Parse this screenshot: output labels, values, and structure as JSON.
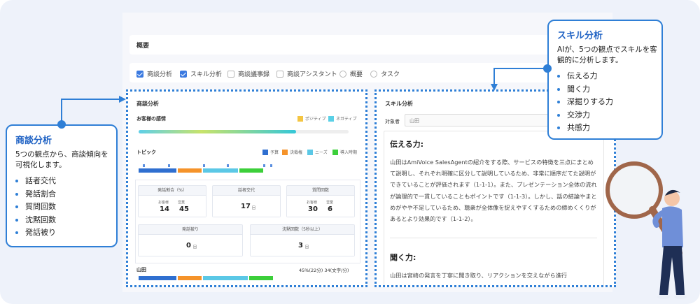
{
  "summary": {
    "label": "概要"
  },
  "tabs": [
    {
      "label": "商談分析",
      "checked": true
    },
    {
      "label": "スキル分析",
      "checked": true
    },
    {
      "label": "商談議事録",
      "checked": false
    },
    {
      "label": "商談アシスタント",
      "checked": false
    },
    {
      "label": "概要",
      "checked": false
    },
    {
      "label": "タスク",
      "checked": false
    }
  ],
  "left_panel": {
    "title": "商談分析",
    "sentiment": {
      "title": "お客様の感情",
      "legend_positive": "ポジティブ",
      "legend_negative": "ネガティブ",
      "positive_color": "#f4c542",
      "negative_color": "#5ad0e6",
      "fill_fraction": 0.75
    },
    "topic": {
      "title": "トピック",
      "legend": [
        "予算",
        "決裁権",
        "ニーズ",
        "導入時期"
      ],
      "colors": [
        "#2f6fd0",
        "#f5932a",
        "#5bc8e6",
        "#3ccf3a"
      ]
    },
    "metrics": {
      "talk_ratio": {
        "label": "発話割合（%）",
        "customer_label": "お客様",
        "sales_label": "営業",
        "customer": "14",
        "sales": "45"
      },
      "speaker_changes": {
        "label": "話者交代",
        "value": "17",
        "unit": "回"
      },
      "questions": {
        "label": "質問回数",
        "customer_label": "お客様",
        "sales_label": "営業",
        "customer": "30",
        "sales": "6"
      },
      "overlap": {
        "label": "発話被り",
        "value": "0",
        "unit": "回"
      },
      "silence": {
        "label": "沈黙回数（5秒以上）",
        "value": "3",
        "unit": "回"
      }
    },
    "speaker": {
      "name": "山田",
      "stat": "45%(22分) 34(文字/分)"
    }
  },
  "right_panel": {
    "title": "スキル分析",
    "target_label": "対象者",
    "target_value": "山田",
    "section1_heading": "伝える力:",
    "section1_text": "山田はAmiVoice SalesAgentの紹介をする際、サービスの特徴を三点にまとめて説明し、それぞれ明確に区分して説明しているため、非常に順序だてた説明ができていることが評価されます（1-1-1）。また、プレゼンテーション全体の流れが論理的で一貫していることもポイントです（1-1-3）。しかし、話の結論やまとめがやや不足しているため、聴衆が全体像を捉えやすくするための締めくくりがあるとより効果的です（1-1-2）。",
    "section2_heading": "聞く力:",
    "section2_text": "山田は宮崎の発言を丁寧に聞き取り、リアクションを交えながら進行"
  },
  "callout_left": {
    "title": "商談分析",
    "description": "5つの観点から、商談傾向を可視化します。",
    "items": [
      "話者交代",
      "発話割合",
      "質問回数",
      "沈黙回数",
      "発話被り"
    ]
  },
  "callout_right": {
    "title": "スキル分析",
    "description": "AIが、5つの観点でスキルを客観的に分析します。",
    "items": [
      "伝える力",
      "聞く力",
      "深掘りする力",
      "交渉力",
      "共感力"
    ]
  },
  "colors": {
    "accent": "#2f7fd6",
    "title_blue": "#1f62c4"
  }
}
